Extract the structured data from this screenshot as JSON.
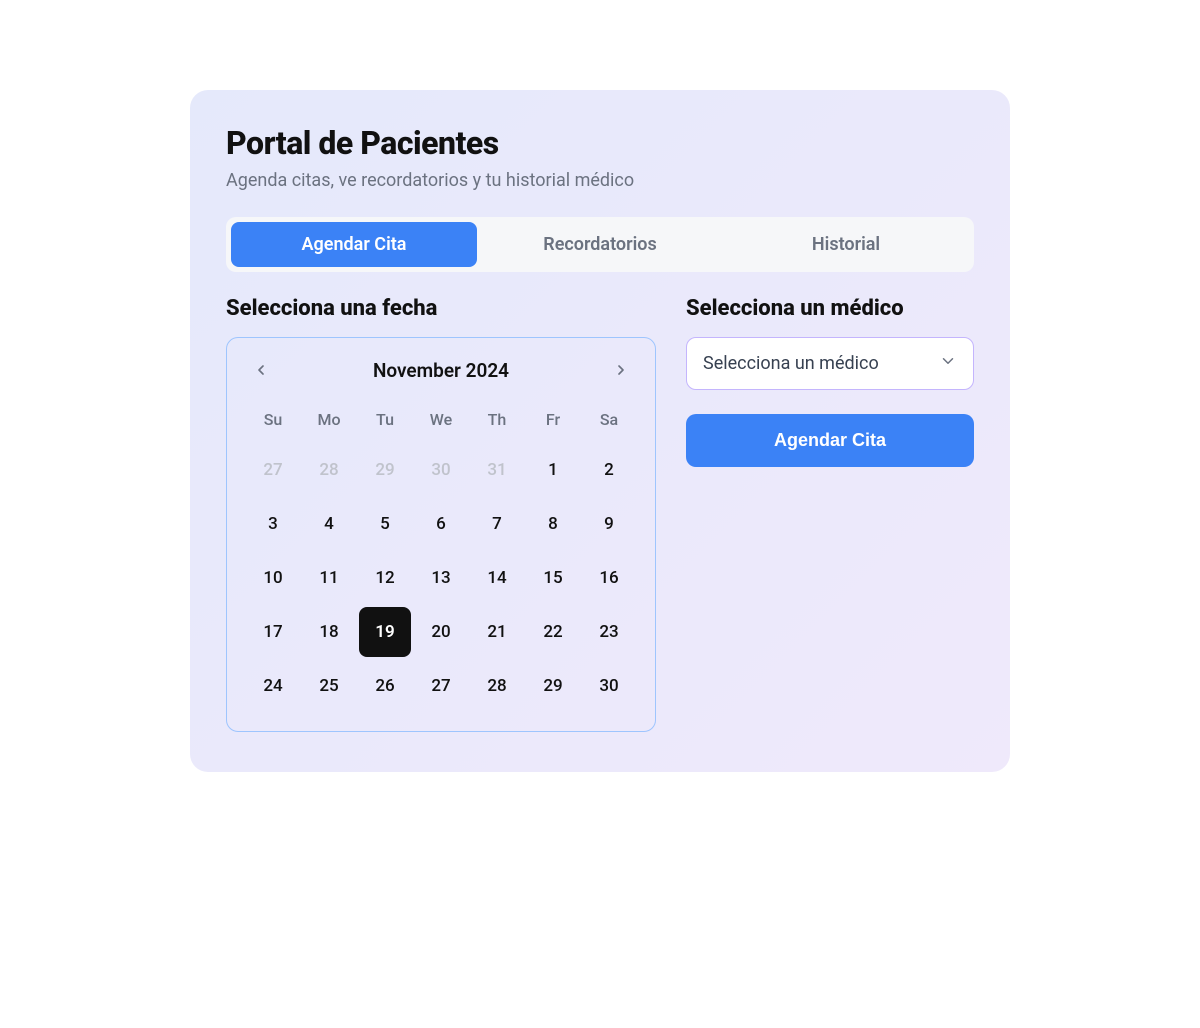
{
  "header": {
    "title": "Portal de Pacientes",
    "subtitle": "Agenda citas, ve recordatorios y tu historial médico"
  },
  "tabs": {
    "items": [
      {
        "label": "Agendar Cita",
        "active": true
      },
      {
        "label": "Recordatorios",
        "active": false
      },
      {
        "label": "Historial",
        "active": false
      }
    ]
  },
  "schedule": {
    "date_section_title": "Selecciona una fecha",
    "doctor_section_title": "Selecciona un médico",
    "doctor_select_placeholder": "Selecciona un médico",
    "submit_label": "Agendar Cita"
  },
  "calendar": {
    "month_label": "November 2024",
    "dow": [
      "Su",
      "Mo",
      "Tu",
      "We",
      "Th",
      "Fr",
      "Sa"
    ],
    "days": [
      {
        "n": "27",
        "outside": true
      },
      {
        "n": "28",
        "outside": true
      },
      {
        "n": "29",
        "outside": true
      },
      {
        "n": "30",
        "outside": true
      },
      {
        "n": "31",
        "outside": true
      },
      {
        "n": "1"
      },
      {
        "n": "2"
      },
      {
        "n": "3"
      },
      {
        "n": "4"
      },
      {
        "n": "5"
      },
      {
        "n": "6"
      },
      {
        "n": "7"
      },
      {
        "n": "8"
      },
      {
        "n": "9"
      },
      {
        "n": "10"
      },
      {
        "n": "11"
      },
      {
        "n": "12"
      },
      {
        "n": "13"
      },
      {
        "n": "14"
      },
      {
        "n": "15"
      },
      {
        "n": "16"
      },
      {
        "n": "17"
      },
      {
        "n": "18"
      },
      {
        "n": "19",
        "selected": true
      },
      {
        "n": "20"
      },
      {
        "n": "21"
      },
      {
        "n": "22"
      },
      {
        "n": "23"
      },
      {
        "n": "24"
      },
      {
        "n": "25"
      },
      {
        "n": "26"
      },
      {
        "n": "27"
      },
      {
        "n": "28"
      },
      {
        "n": "29"
      },
      {
        "n": "30"
      }
    ]
  }
}
